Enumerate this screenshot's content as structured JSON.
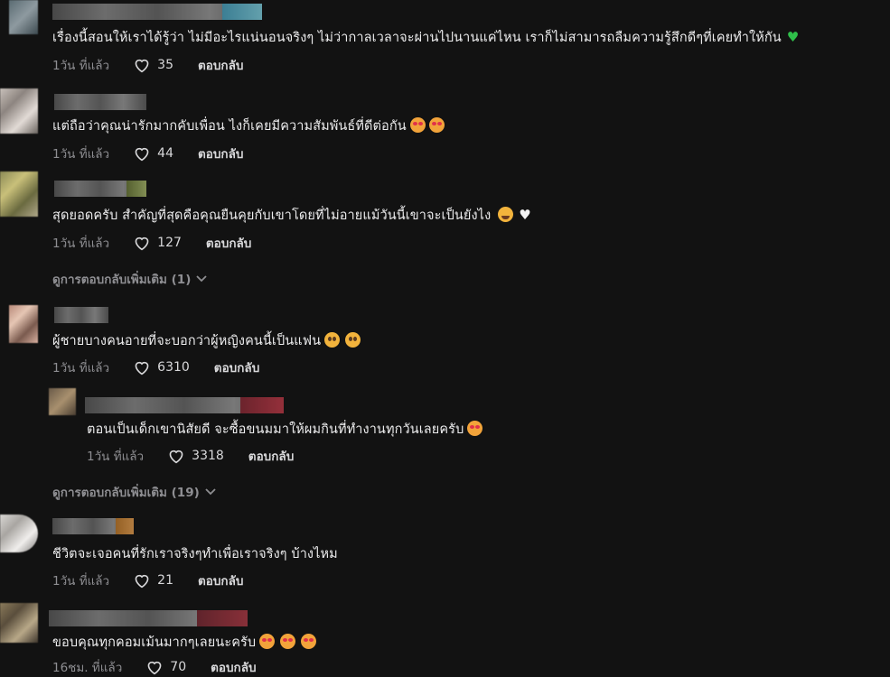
{
  "comments": [
    {
      "text": "เรื่องนี้สอนให้เราได้รู้ว่า ไม่มีอะไรแน่นอนจริงๆ ไม่ว่ากาลเวลาจะผ่านไปนานแค่ไหน เราก็ไม่สามารถลืมความรู้สึกดีๆที่เคยทำให้กัน",
      "emoji": [
        "green-heart"
      ],
      "time": "1วัน ที่แล้ว",
      "likes": "35",
      "reply": "ตอบกลับ"
    },
    {
      "text": "แต่ถือว่าคุณน่ารักมากคับเพื่อน ไงก็เคยมีความสัมพันธ์ที่ดีต่อกัน",
      "emoji": [
        "heart-eyes",
        "heart-eyes"
      ],
      "time": "1วัน ที่แล้ว",
      "likes": "44",
      "reply": "ตอบกลับ"
    },
    {
      "text": "สุดยอดครับ สำคัญที่สุดคือคุณยืนคุยกับเขาโดยที่ไม่อายแม้วันนี้เขาจะเป็นยังไง",
      "emoji": [
        "laughing",
        "white-heart"
      ],
      "time": "1วัน ที่แล้ว",
      "likes": "127",
      "reply": "ตอบกลับ"
    },
    {
      "text": "ผู้ชายบางคนอายที่จะบอกว่าผู้หญิงคนนี้เป็นแฟน",
      "emoji": [
        "pleading",
        "pleading"
      ],
      "time": "1วัน ที่แล้ว",
      "likes": "6310",
      "reply": "ตอบกลับ"
    },
    {
      "text": "ตอนเป็นเด็กเขานิสัยดี จะซื้อขนมมาให้ผมกินที่ทำงานทุกวันเลยครับ",
      "emoji": [
        "heart-eyes"
      ],
      "time": "1วัน ที่แล้ว",
      "likes": "3318",
      "reply": "ตอบกลับ"
    },
    {
      "text": "ชีวิตจะเจอคนที่รักเราจริงๆทำเพื่อเราจริงๆ บ้างไหม",
      "emoji": [],
      "time": "1วัน ที่แล้ว",
      "likes": "21",
      "reply": "ตอบกลับ"
    },
    {
      "text": "ขอบคุณทุกคอมเม้นมากๆเลยนะครับ",
      "emoji": [
        "heart-eyes",
        "heart-eyes",
        "heart-eyes"
      ],
      "time": "16ชม. ที่แล้ว",
      "likes": "70",
      "reply": "ตอบกลับ"
    }
  ],
  "more_replies": [
    {
      "label": "ดูการตอบกลับเพิ่มเติม (1)"
    },
    {
      "label": "ดูการตอบกลับเพิ่มเติม (19)"
    }
  ],
  "icons": {
    "like": "heart-outline-icon",
    "expand": "chevron-down-icon"
  },
  "colors": {
    "background": "#121212",
    "text": "#ededee",
    "meta": "#8e8e92"
  }
}
